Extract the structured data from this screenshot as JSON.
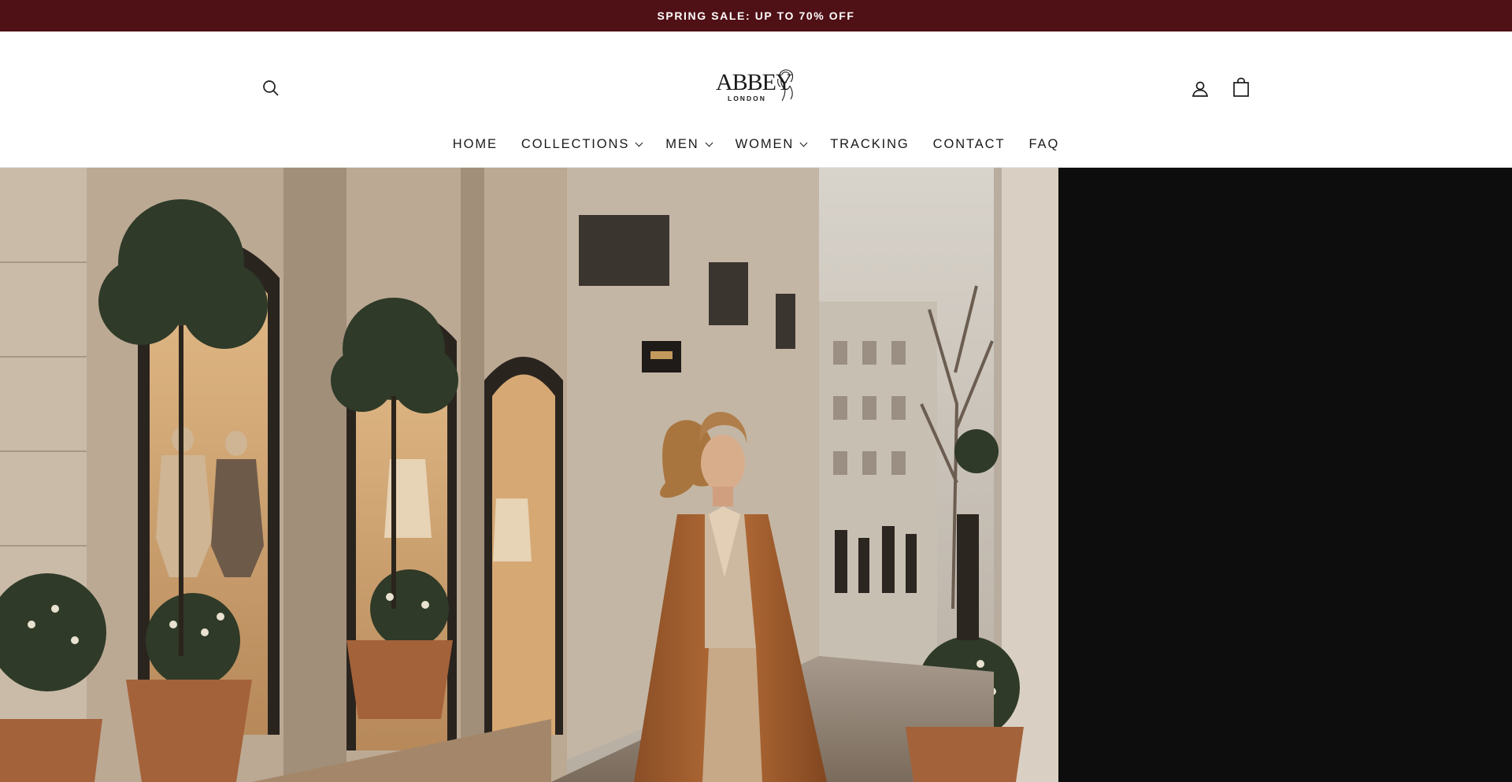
{
  "announcement": {
    "text": "SPRING SALE: UP TO 70% OFF"
  },
  "header": {
    "logo": {
      "word": "ABBEY",
      "sub": "LONDON"
    },
    "icons": {
      "search": "search-icon",
      "account": "user-icon",
      "cart": "shopping-bag-icon"
    }
  },
  "nav": {
    "items": [
      {
        "label": "HOME",
        "dropdown": false
      },
      {
        "label": "COLLECTIONS",
        "dropdown": true
      },
      {
        "label": "MEN",
        "dropdown": true
      },
      {
        "label": "WOMEN",
        "dropdown": true
      },
      {
        "label": "TRACKING",
        "dropdown": false
      },
      {
        "label": "CONTACT",
        "dropdown": false
      },
      {
        "label": "FAQ",
        "dropdown": false
      }
    ]
  },
  "colors": {
    "announcement_bg": "#4f1016",
    "hero_dark": "#0d0d0d"
  }
}
